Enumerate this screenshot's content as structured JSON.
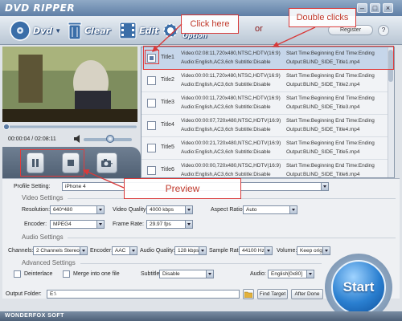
{
  "app": {
    "title": "DVD RIPPER"
  },
  "toolbar": {
    "dvd_label": "Dvd",
    "clear_label": "Clear",
    "edit_label": "Edit",
    "option_label": "Option",
    "register_label": "Register",
    "or_text": "or"
  },
  "player": {
    "time": "00:00:04 / 02:08:11",
    "volume_level": 0.55,
    "seek_position": 0.02
  },
  "titles": [
    {
      "name": "Title1",
      "line1_left": "Video:02:08:11,720x480,NTSC,HDTV(16:9)",
      "line1_right": "Start Time:Beginning End Time:Ending",
      "line2_left": "Audio:English,AC3,6ch Subtitle:Disable",
      "line2_right": "Output:BLIND_SIDE_Title1.mp4",
      "checked": true
    },
    {
      "name": "Title2",
      "line1_left": "Video:00:00:11,720x480,NTSC,HDTV(16:9)",
      "line1_right": "Start Time:Beginning End Time:Ending",
      "line2_left": "Audio:English,AC3,6ch Subtitle:Disable",
      "line2_right": "Output:BLIND_SIDE_Title2.mp4",
      "checked": false
    },
    {
      "name": "Title3",
      "line1_left": "Video:00:00:11,720x480,NTSC,HDTV(16:9)",
      "line1_right": "Start Time:Beginning End Time:Ending",
      "line2_left": "Audio:English,AC3,6ch Subtitle:Disable",
      "line2_right": "Output:BLIND_SIDE_Title3.mp4",
      "checked": false
    },
    {
      "name": "Title4",
      "line1_left": "Video:00:00:07,720x480,NTSC,HDTV(16:9)",
      "line1_right": "Start Time:Beginning End Time:Ending",
      "line2_left": "Audio:English,AC3,6ch Subtitle:Disable",
      "line2_right": "Output:BLIND_SIDE_Title4.mp4",
      "checked": false
    },
    {
      "name": "Title5",
      "line1_left": "Video:00:00:21,720x480,NTSC,HDTV(16:9)",
      "line1_right": "Start Time:Beginning End Time:Ending",
      "line2_left": "Audio:English,AC3,6ch Subtitle:Disable",
      "line2_right": "Output:BLIND_SIDE_Title5.mp4",
      "checked": false
    },
    {
      "name": "Title6",
      "line1_left": "Video:00:00:00,720x480,NTSC,HDTV(16:9)",
      "line1_right": "Start Time:Beginning End Time:Ending",
      "line2_left": "Audio:English,AC3,6ch Subtitle:Disable",
      "line2_right": "Output:BLIND_SIDE_Title6.mp4",
      "checked": false
    }
  ],
  "settings": {
    "profile_label": "Profile Setting:",
    "profile_value": "iPhone 4",
    "video_header": "Video Settings",
    "resolution_label": "Resolution:",
    "resolution_value": "640*480",
    "video_quality_label": "Video Quality:",
    "video_quality_value": "4000 kbps",
    "aspect_ratio_label": "Aspect Ratio:",
    "aspect_ratio_value": "Auto",
    "encoder_label": "Encoder:",
    "encoder_value": "MPEG4",
    "frame_rate_label": "Frame Rate:",
    "frame_rate_value": "29.97 fps",
    "audio_header": "Audio Settings",
    "channels_label": "Channels:",
    "channels_value": "2 Channels Stereo",
    "audio_encoder_label": "Encoder:",
    "audio_encoder_value": "AAC",
    "audio_quality_label": "Audio Quality:",
    "audio_quality_value": "128 kbps",
    "sample_rate_label": "Sample Rate:",
    "sample_rate_value": "44100 Hz",
    "volume_label": "Volume:",
    "volume_value": "Keep origina",
    "advanced_header": "Advanced Settings",
    "deinterlace_label": "Deinterlace",
    "merge_label": "Merge into one file",
    "subtitle_label": "Subtitle:",
    "subtitle_value": "Disable",
    "audio_label": "Audio:",
    "audio_value": "English[0x80]"
  },
  "output": {
    "folder_label": "Output Folder:",
    "folder_value": "E:\\",
    "find_target_label": "Find Target",
    "after_done_label": "After Done"
  },
  "start": {
    "label": "Start"
  },
  "footer": {
    "brand": "WONDERFOX SOFT"
  },
  "annotations": {
    "click_here": "Click here",
    "double_clicks": "Double clicks",
    "preview": "Preview"
  },
  "colors": {
    "accent": "#2a7fd0",
    "annotation": "#d83a3a",
    "toolbar_label": "#ffffff"
  }
}
